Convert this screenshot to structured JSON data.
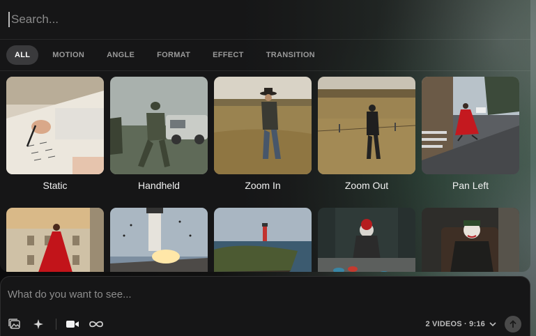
{
  "search": {
    "placeholder": "Search..."
  },
  "tabs": [
    {
      "label": "ALL",
      "active": true
    },
    {
      "label": "MOTION",
      "active": false
    },
    {
      "label": "ANGLE",
      "active": false
    },
    {
      "label": "FORMAT",
      "active": false
    },
    {
      "label": "EFFECT",
      "active": false
    },
    {
      "label": "TRANSITION",
      "active": false
    }
  ],
  "presets": [
    {
      "label": "Static"
    },
    {
      "label": "Handheld"
    },
    {
      "label": "Zoom In"
    },
    {
      "label": "Zoom Out"
    },
    {
      "label": "Pan Left"
    }
  ],
  "composer": {
    "placeholder": "What do you want to see...",
    "settings_label": "2 VIDEOS · 9:16",
    "icons": [
      "image-upload-icon",
      "sparkle-icon",
      "video-camera-icon",
      "infinity-loop-icon",
      "chevron-down-icon",
      "arrow-up-icon"
    ]
  }
}
